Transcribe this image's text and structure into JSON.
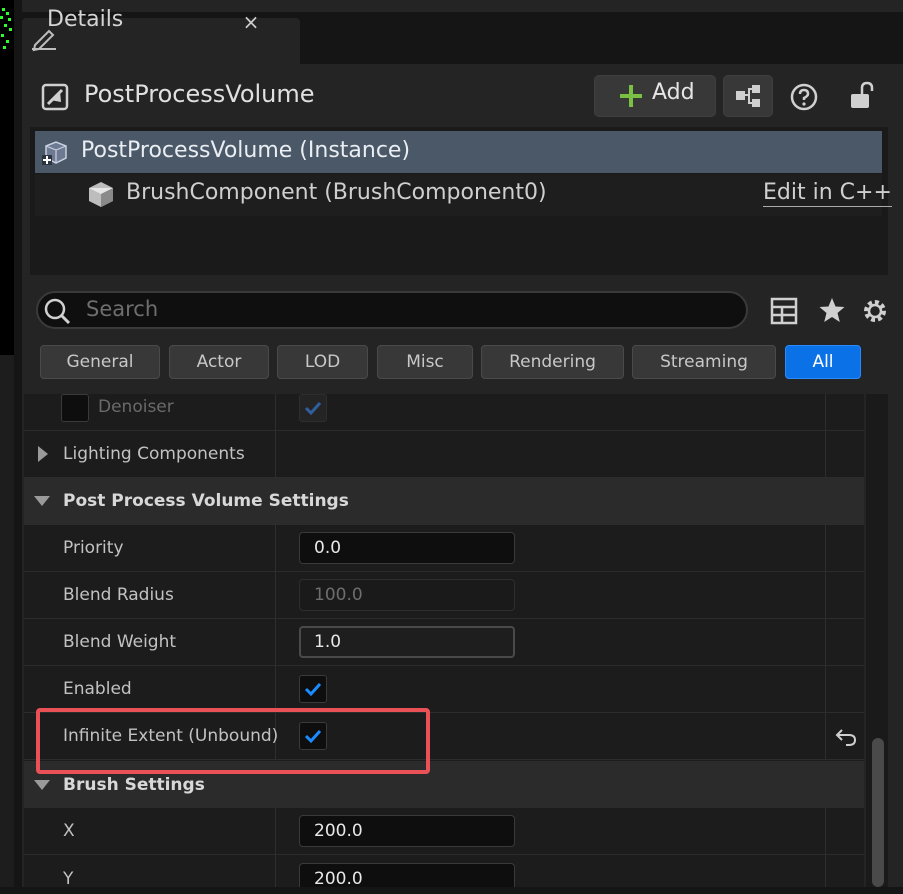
{
  "tab": {
    "title": "Details",
    "close": "×"
  },
  "header": {
    "actor_name": "PostProcessVolume",
    "add_label": "Add"
  },
  "components": {
    "instance_label": "PostProcessVolume (Instance)",
    "brush_label": "BrushComponent (BrushComponent0)",
    "edit_link": "Edit in C++"
  },
  "search": {
    "placeholder": "Search"
  },
  "filters": [
    "General",
    "Actor",
    "LOD",
    "Misc",
    "Rendering",
    "Streaming",
    "All"
  ],
  "active_filter": "All",
  "properties": {
    "denoiser": "Denoiser",
    "lighting_components": "Lighting Components",
    "post_process_settings": "Post Process Volume Settings",
    "priority": {
      "label": "Priority",
      "value": "0.0"
    },
    "blend_radius": {
      "label": "Blend Radius",
      "value": "100.0"
    },
    "blend_weight": {
      "label": "Blend Weight",
      "value": "1.0"
    },
    "enabled": {
      "label": "Enabled",
      "checked": true
    },
    "infinite_extent": {
      "label": "Infinite Extent (Unbound)",
      "checked": true
    },
    "brush_settings": "Brush Settings",
    "x": {
      "label": "X",
      "value": "200.0"
    },
    "y": {
      "label": "Y",
      "value": "200.0"
    }
  },
  "colors": {
    "accent": "#0a72e6",
    "highlight": "#ea5157",
    "selected_row": "#4a5868"
  },
  "icons": [
    "pen-icon",
    "close-icon",
    "actor-icon",
    "plus-icon",
    "blueprint-icon",
    "help-icon",
    "lock-icon",
    "instance-icon",
    "cube-icon",
    "search-icon",
    "grid-icon",
    "star-icon",
    "gear-icon",
    "reset-arrow-icon",
    "checkmark-icon"
  ]
}
